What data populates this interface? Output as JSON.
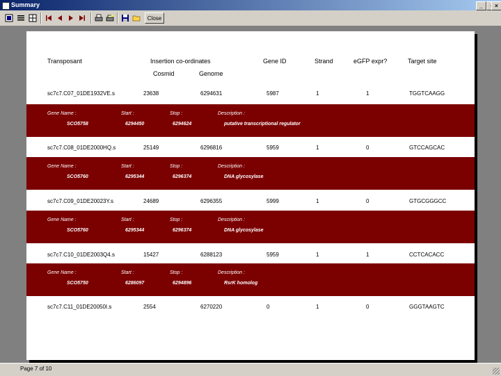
{
  "window": {
    "title": "Summary"
  },
  "toolbar": {
    "close_label": "Close"
  },
  "headers": {
    "transposant": "Transposant",
    "insertion": "Insertion co-ordinates",
    "cosmid": "Cosmid",
    "genome": "Genome",
    "gene_id": "Gene ID",
    "strand": "Strand",
    "egfp": "eGFP expr?",
    "target": "Target site"
  },
  "detail_labels": {
    "gene_name": "Gene Name :",
    "start": "Start :",
    "stop": "Stop :",
    "description": "Description :"
  },
  "rows": [
    {
      "transposant": "sc7c7.C07_01DE1932VE.s",
      "cosmid": "23638",
      "genome": "6294631",
      "gene_id": "5987",
      "strand": "1",
      "egfp": "1",
      "target": "TGGTCAAGG",
      "gene_name": "SCO5758",
      "start": "6294450",
      "stop": "6294624",
      "description": "putative transcriptional regulator"
    },
    {
      "transposant": "sc7c7.C08_01DE2000HQ.s",
      "cosmid": "25149",
      "genome": "6296816",
      "gene_id": "5959",
      "strand": "1",
      "egfp": "0",
      "target": "GTCCAGCAC",
      "gene_name": "SCO5760",
      "start": "6295344",
      "stop": "6296374",
      "description": "DNA glycosylase"
    },
    {
      "transposant": "sc7c7.C09_01DE20023Y.s",
      "cosmid": "24689",
      "genome": "6296355",
      "gene_id": "5999",
      "strand": "1",
      "egfp": "0",
      "target": "GTGCGGGCC",
      "gene_name": "SCO5760",
      "start": "6295344",
      "stop": "6296374",
      "description": "DNA glycosylase"
    },
    {
      "transposant": "sc7c7.C10_01DE2003Q4.s",
      "cosmid": "15427",
      "genome": "6288123",
      "gene_id": "5959",
      "strand": "1",
      "egfp": "1",
      "target": "CCTCACACC",
      "gene_name": "SCO5750",
      "start": "6286097",
      "stop": "6294896",
      "description": "RsrK homolog"
    },
    {
      "transposant": "sc7c7.C11_01DE20050I.s",
      "cosmid": "2554",
      "genome": "6270220",
      "gene_id": "0",
      "strand": "1",
      "egfp": "0",
      "target": "GGGTAAGTC"
    }
  ],
  "status": {
    "text": "Page 7 of 10"
  }
}
